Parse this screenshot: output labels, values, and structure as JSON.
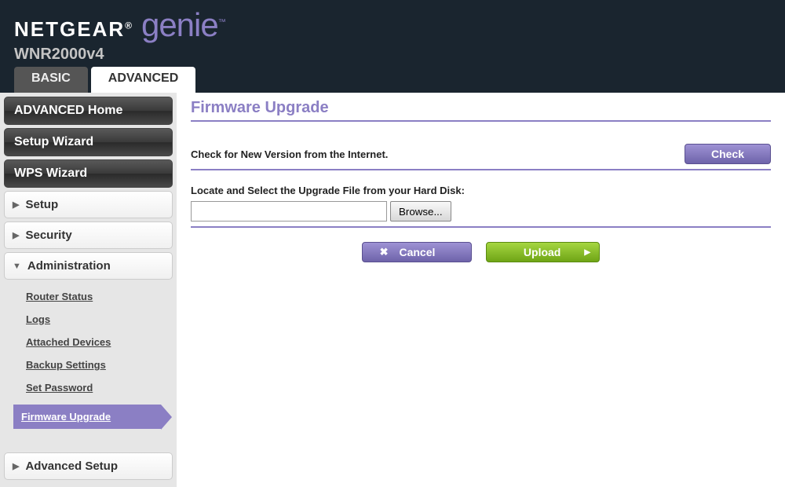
{
  "brand": {
    "name": "NETGEAR",
    "sub": "genie",
    "tm": "™",
    "reg": "®"
  },
  "model": "WNR2000v4",
  "tabs": {
    "basic": "BASIC",
    "advanced": "ADVANCED"
  },
  "sidebar": {
    "advanced_home": "ADVANCED Home",
    "setup_wizard": "Setup Wizard",
    "wps_wizard": "WPS Wizard",
    "setup": "Setup",
    "security": "Security",
    "administration": "Administration",
    "advanced_setup": "Advanced Setup",
    "admin_items": {
      "router_status": "Router Status",
      "logs": "Logs",
      "attached_devices": "Attached Devices",
      "backup_settings": "Backup Settings",
      "set_password": "Set Password",
      "firmware_upgrade": "Firmware Upgrade"
    }
  },
  "main": {
    "title": "Firmware Upgrade",
    "check_label": "Check for New Version from the Internet.",
    "check_button": "Check",
    "locate_label": "Locate and Select the Upgrade File from your Hard Disk:",
    "browse_button": "Browse...",
    "file_value": "",
    "cancel_button": "Cancel",
    "upload_button": "Upload"
  }
}
